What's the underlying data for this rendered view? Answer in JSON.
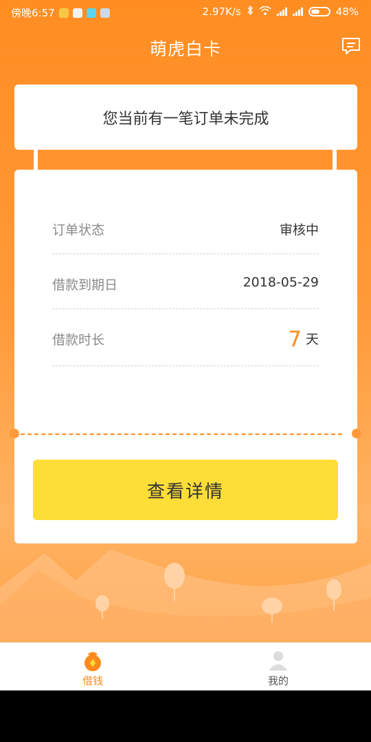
{
  "status_bar": {
    "time": "傍晚6:57",
    "net_speed": "2.97K/s",
    "battery": "48%",
    "battery_level": 0.48,
    "notification_icons": [
      "sun-app-icon",
      "chat-app-icon",
      "browser-icon",
      "file-icon"
    ],
    "colors": {
      "app1": "#f7c943",
      "app2": "#f2f2f2",
      "app3": "#5ad4f0",
      "app4": "#cfd8e3"
    }
  },
  "header": {
    "title": "萌虎白卡",
    "message_icon": "message-icon"
  },
  "notice": {
    "text": "您当前有一笔订单未完成"
  },
  "order": {
    "rows": [
      {
        "label": "订单状态",
        "value": "审核中"
      },
      {
        "label": "借款到期日",
        "value": "2018-05-29"
      },
      {
        "label": "借款时长",
        "value_number": "7",
        "value_unit": "天"
      }
    ],
    "detail_button": "查看详情"
  },
  "bottom_nav": {
    "items": [
      {
        "label": "借钱",
        "icon": "money-bag-icon",
        "active": true
      },
      {
        "label": "我的",
        "icon": "user-icon",
        "active": false
      }
    ]
  },
  "colors": {
    "primary_orange": "#ff8d22",
    "accent_orange": "#ff8a1c",
    "button_yellow": "#fddd37"
  }
}
